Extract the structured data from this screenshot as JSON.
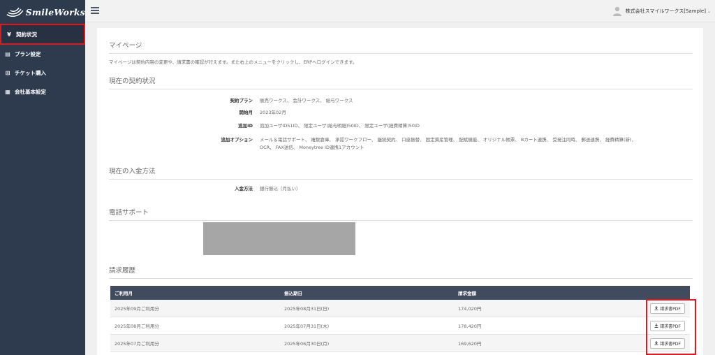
{
  "app": {
    "logo_text": "SmileWorks"
  },
  "sidebar": {
    "items": [
      {
        "label": "契約状況",
        "icon": "yen-icon",
        "glyph": "¥"
      },
      {
        "label": "プラン設定",
        "icon": "plan-icon",
        "glyph": "▤"
      },
      {
        "label": "チケット購入",
        "icon": "plus-square-icon",
        "glyph": "⊞"
      },
      {
        "label": "会社基本設定",
        "icon": "building-icon",
        "glyph": "▦"
      }
    ]
  },
  "header": {
    "company": "株式会社スマイルワークス[Sample]",
    "caret": "⌄"
  },
  "mypage": {
    "title": "マイページ",
    "lead": "マイページは契約内容の変更や、請求書の確認が行えます。また右上のメニューをクリックし、ERPへログインできます。"
  },
  "contract": {
    "title": "現在の契約状況",
    "rows": [
      {
        "label": "契約プラン",
        "value": "販売ワークス、 会計ワークス、 給与ワークス"
      },
      {
        "label": "開始月",
        "value": "2023年02月"
      },
      {
        "label": "追加ID",
        "value": "追加ユーザID51ID、 限定ユーザ(給与明細)50ID、 限定ユーザ(経費精算)50ID"
      },
      {
        "label": "追加オプション",
        "value": "メール＆電話サポート、 複数倉庫、 承認ワークフロー、 継続契約、 口座振替、 固定資産管理、 配賦機能、 オリジナル帳票、 Bカート連携、 受発注同時、 郵送連携、 経費精算(新)、 OCR、 FAX送信、 Moneytree ID連携1アカウント"
      }
    ]
  },
  "payment": {
    "title": "現在の入金方法",
    "rows": [
      {
        "label": "入金方法",
        "value": "銀行振込（月払い）"
      }
    ]
  },
  "phone": {
    "title": "電話サポート"
  },
  "billing": {
    "title": "請求履歴",
    "columns": [
      "ご利用月",
      "振込期日",
      "請求金額",
      ""
    ],
    "button_label": "請求書PDF",
    "rows": [
      {
        "month": "2025年09月ご利用分",
        "due": "2025年08月31日(日)",
        "amount": "174,020円"
      },
      {
        "month": "2025年08月ご利用分",
        "due": "2025年07月31日(木)",
        "amount": "178,420円"
      },
      {
        "month": "2025年07月ご利用分",
        "due": "2025年06月30日(月)",
        "amount": "169,620円"
      }
    ]
  },
  "colors": {
    "sidebar": "#2e3b4e",
    "table_header": "#414b5e",
    "highlight": "#e4151b"
  }
}
